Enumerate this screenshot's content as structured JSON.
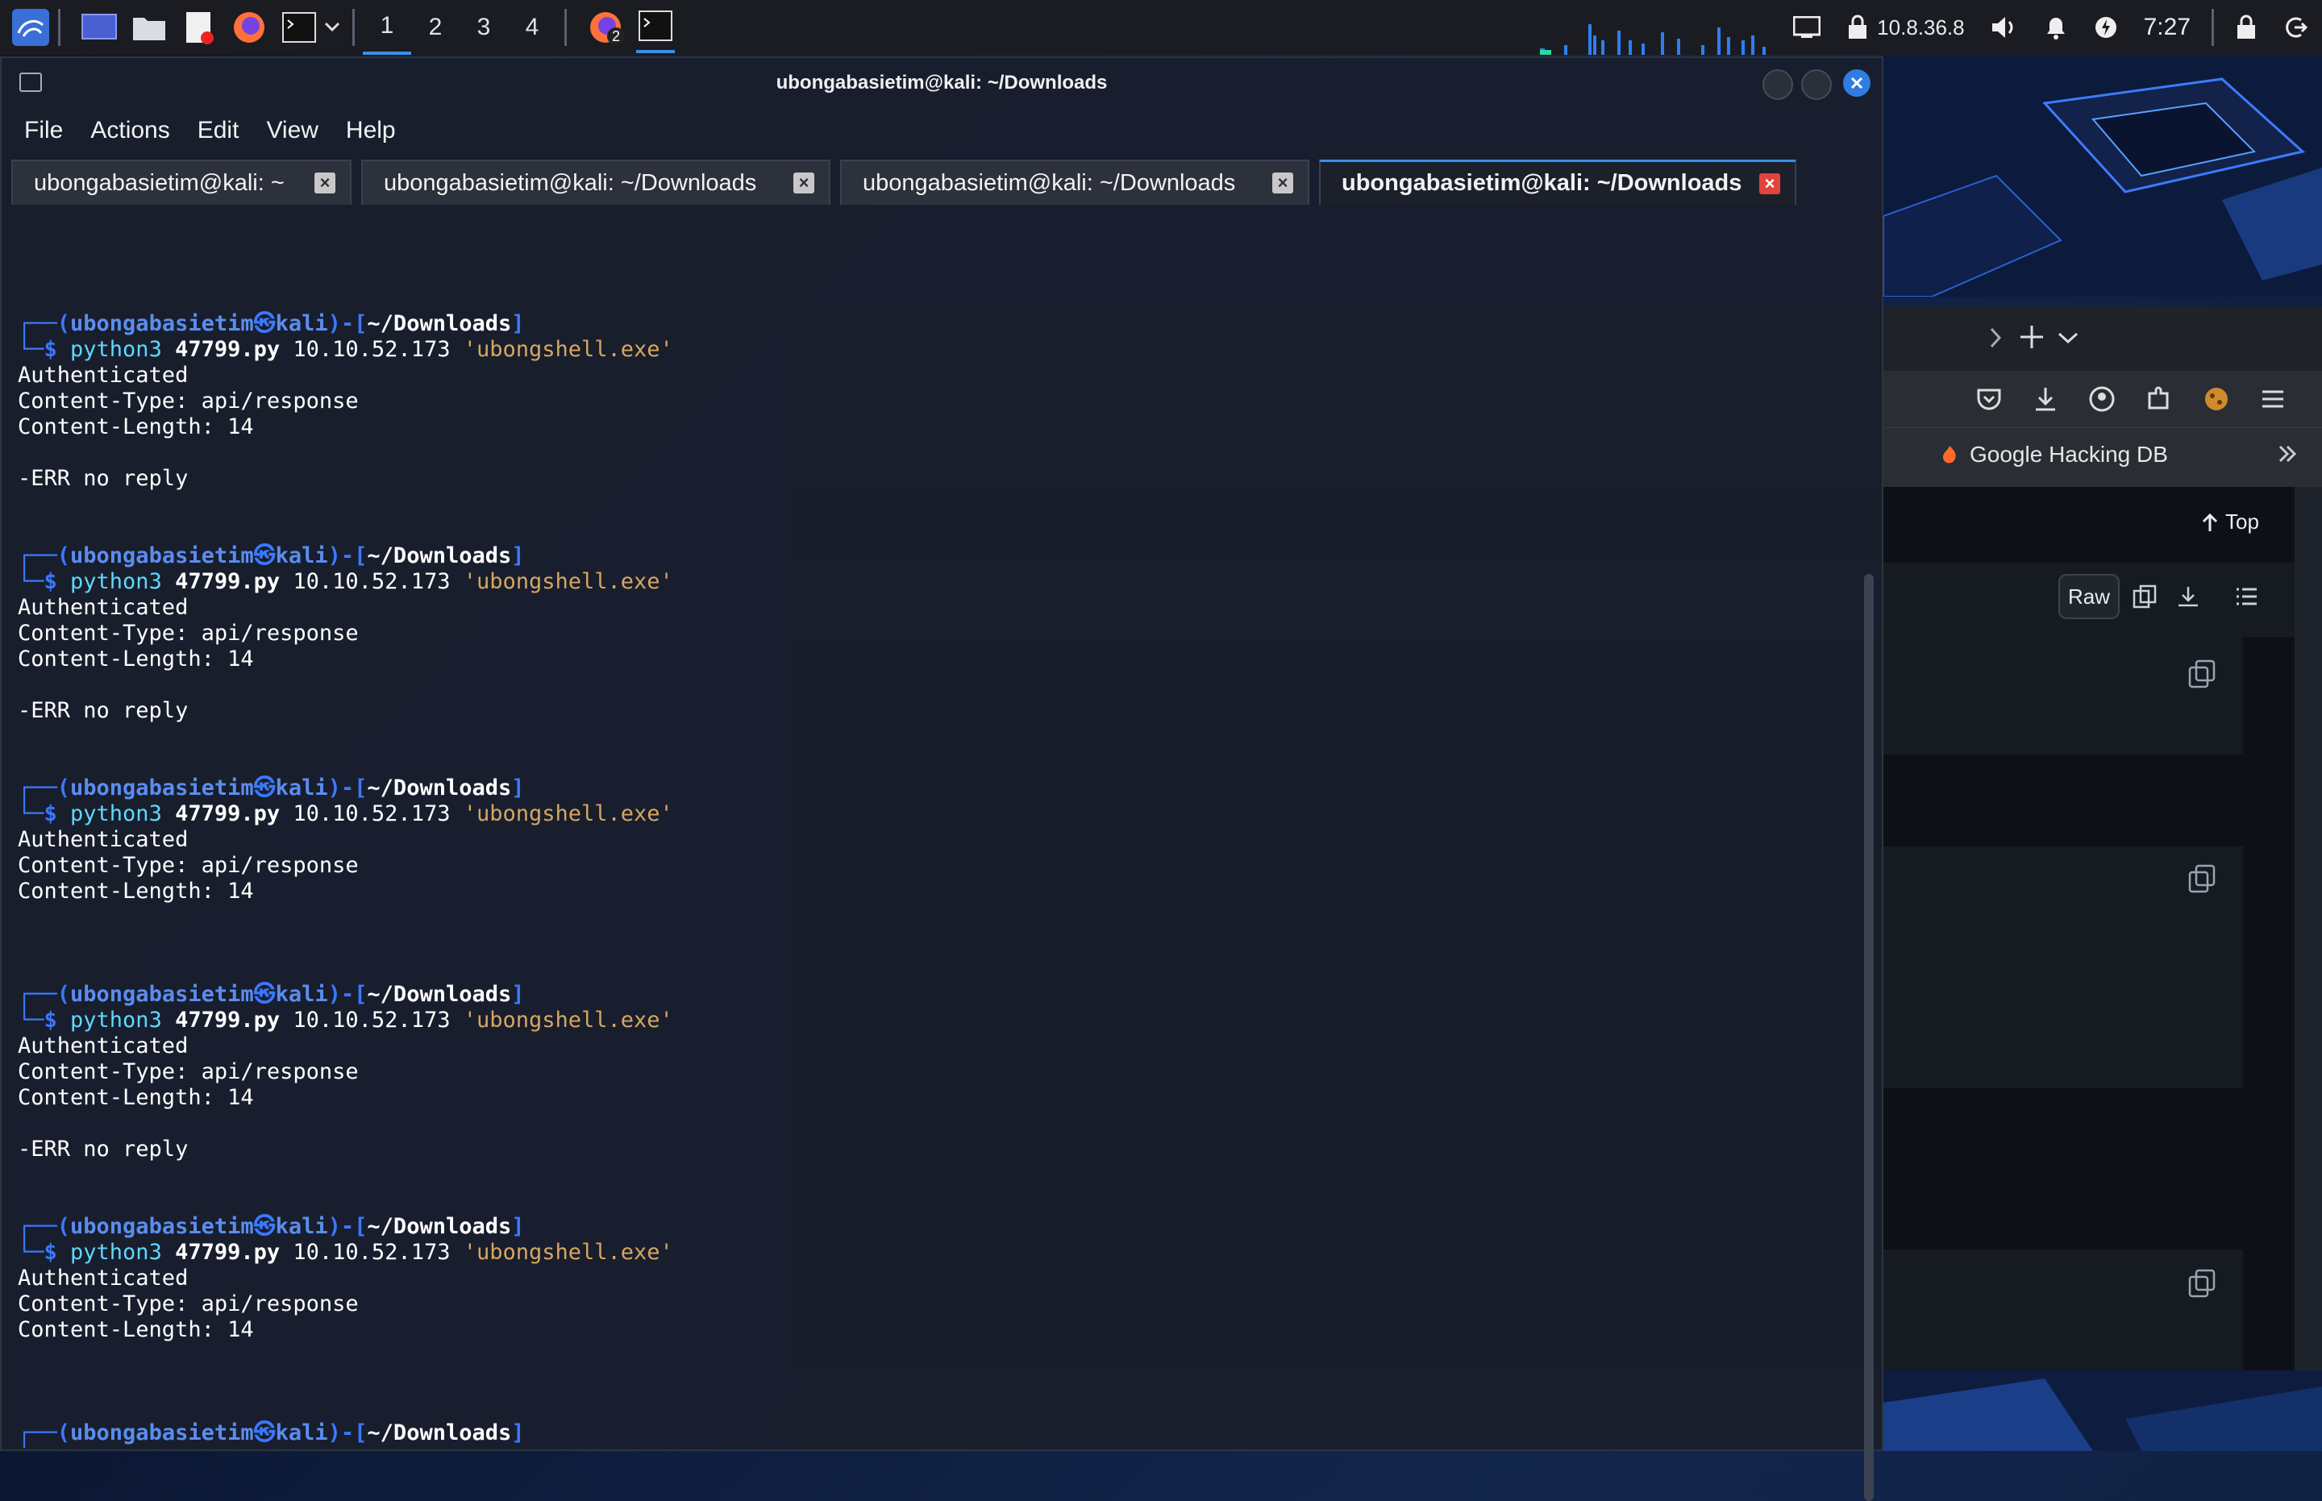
{
  "panel": {
    "workspaces": [
      "1",
      "2",
      "3",
      "4"
    ],
    "active_workspace": "1",
    "firefox_badge": "2",
    "ip": "10.8.36.8",
    "clock": "7:27"
  },
  "browser": {
    "bookmark_visible": "Google Hacking DB",
    "top_label": "Top",
    "raw_label": "Raw"
  },
  "terminal": {
    "title": "ubongabasietim@kali: ~/Downloads",
    "menu": [
      "File",
      "Actions",
      "Edit",
      "View",
      "Help"
    ],
    "tabs": [
      {
        "label": "ubongabasietim@kali: ~"
      },
      {
        "label": "ubongabasietim@kali: ~/Downloads"
      },
      {
        "label": "ubongabasietim@kali: ~/Downloads"
      },
      {
        "label": "ubongabasietim@kali: ~/Downloads"
      }
    ],
    "prompt": {
      "open": "┌──(",
      "user": "ubongabasietim",
      "at": "㉿",
      "host": "kali",
      "mid": ")-[",
      "dir": "~/Downloads",
      "close": "]",
      "second": "└─$"
    },
    "command": {
      "cmd": "python3",
      "script": "47799.py",
      "ip": "10.10.52.173",
      "arg": "'ubongshell.exe'"
    },
    "output": {
      "auth": "Authenticated",
      "ctype": "Content-Type: api/response",
      "clen": "Content-Length: 14",
      "err": "-ERR no reply"
    }
  }
}
